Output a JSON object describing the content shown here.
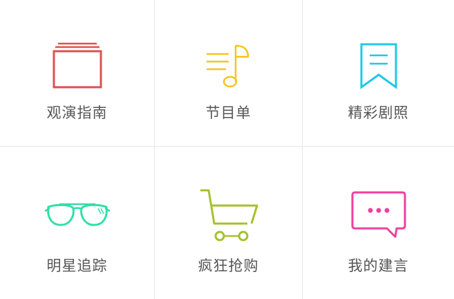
{
  "menu": {
    "items": [
      {
        "label": "观演指南",
        "icon": "ticket-stack-icon",
        "color": "#d9534f"
      },
      {
        "label": "节目单",
        "icon": "music-note-list-icon",
        "color": "#f5c518"
      },
      {
        "label": "精彩剧照",
        "icon": "bookmark-icon",
        "color": "#1ec8e8"
      },
      {
        "label": "明星追踪",
        "icon": "sunglasses-icon",
        "color": "#2ee0a8"
      },
      {
        "label": "疯狂抢购",
        "icon": "shopping-cart-icon",
        "color": "#a4c12e"
      },
      {
        "label": "我的建言",
        "icon": "chat-bubble-icon",
        "color": "#ef3fa0"
      }
    ]
  }
}
